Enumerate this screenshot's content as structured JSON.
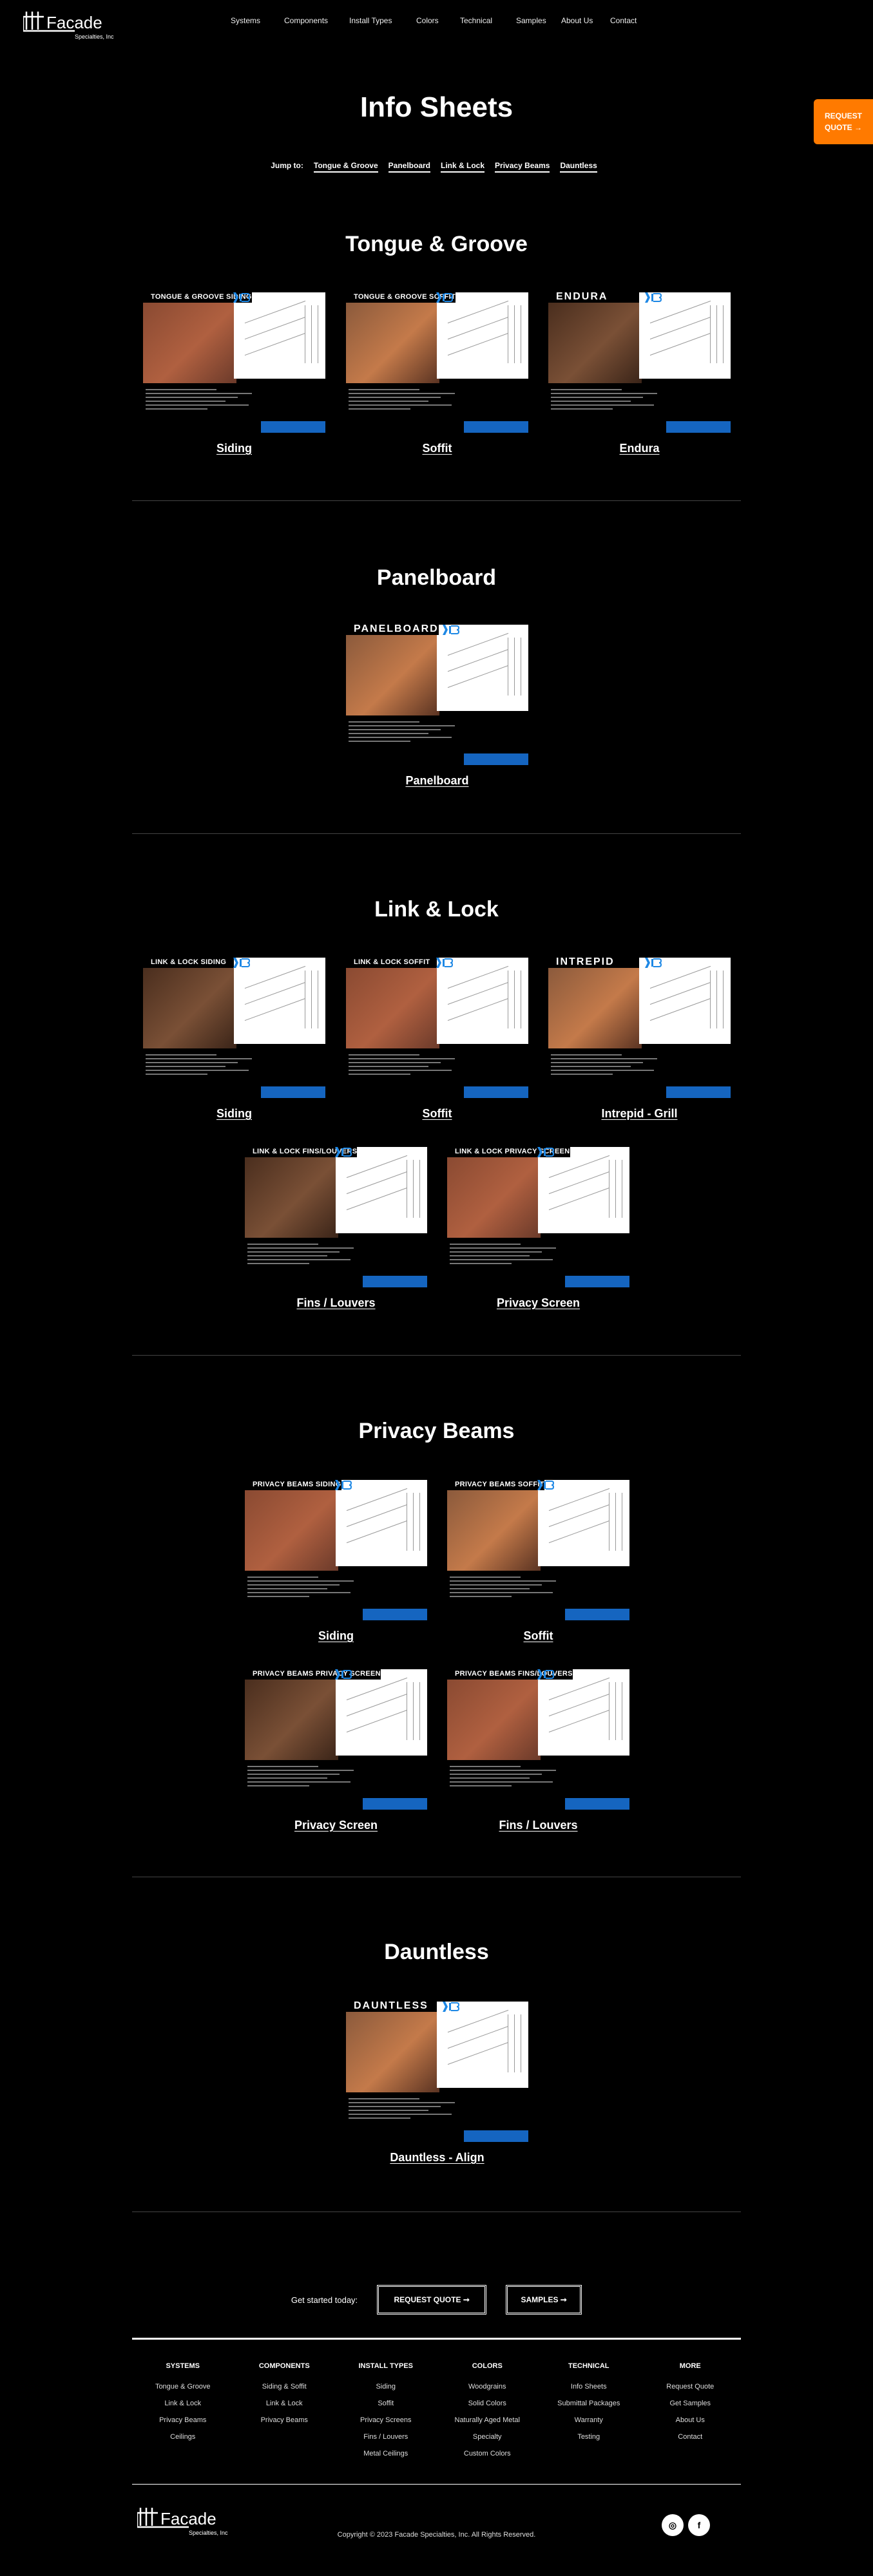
{
  "brand": {
    "name": "Facade",
    "subtitle": "Specialties, Inc"
  },
  "nav": [
    "Systems",
    "Components",
    "Install Types",
    "Colors",
    "Technical",
    "Samples",
    "About Us",
    "Contact"
  ],
  "request_tab": {
    "line1": "REQUEST",
    "line2": "QUOTE →",
    "color": "#ff7a00"
  },
  "page_title": "Info Sheets",
  "jump": {
    "label": "Jump to:",
    "links": [
      "Tongue & Groove",
      "Panelboard",
      "Link & Lock",
      "Privacy Beams",
      "Dauntless"
    ]
  },
  "sections": [
    {
      "title": "Tongue & Groove",
      "sheets": [
        {
          "header": "TONGUE & GROOVE SIDING",
          "caption": "Siding"
        },
        {
          "header": "TONGUE & GROOVE SOFFIT",
          "caption": "Soffit"
        },
        {
          "header": "ENDURA",
          "caption": "Endura"
        }
      ]
    },
    {
      "title": "Panelboard",
      "sheets": [
        {
          "header": "PANELBOARD",
          "caption": "Panelboard"
        }
      ]
    },
    {
      "title": "Link & Lock",
      "sheets": [
        {
          "header": "LINK & LOCK SIDING",
          "caption": "Siding"
        },
        {
          "header": "LINK & LOCK SOFFIT",
          "caption": "Soffit"
        },
        {
          "header": "INTREPID",
          "caption": "Intrepid - Grill"
        },
        {
          "header": "LINK & LOCK FINS/LOUVERS",
          "caption": "Fins / Louvers"
        },
        {
          "header": "LINK & LOCK PRIVACY SCREEN",
          "caption": "Privacy Screen"
        }
      ]
    },
    {
      "title": "Privacy Beams",
      "sheets": [
        {
          "header": "PRIVACY BEAMS SIDING",
          "caption": "Siding"
        },
        {
          "header": "PRIVACY BEAMS SOFFIT",
          "caption": "Soffit"
        },
        {
          "header": "PRIVACY BEAMS PRIVACY SCREEN",
          "caption": "Privacy Screen"
        },
        {
          "header": "PRIVACY BEAMS FINS/LOUVERS",
          "caption": "Fins / Louvers"
        }
      ]
    },
    {
      "title": "Dauntless",
      "sheets": [
        {
          "header": "DAUNTLESS",
          "caption": "Dauntless - Align"
        }
      ]
    }
  ],
  "cta": {
    "label": "Get started today:",
    "quote": "REQUEST QUOTE ➞",
    "samples": "SAMPLES ➞"
  },
  "footer": {
    "columns": [
      {
        "title": "SYSTEMS",
        "links": [
          "Tongue & Groove",
          "Link & Lock",
          "Privacy Beams",
          "Ceilings"
        ]
      },
      {
        "title": "COMPONENTS",
        "links": [
          "Siding & Soffit",
          "Link & Lock",
          "Privacy Beams"
        ]
      },
      {
        "title": "INSTALL TYPES",
        "links": [
          "Siding",
          "Soffit",
          "Privacy Screens",
          "Fins / Louvers",
          "Metal Ceilings"
        ]
      },
      {
        "title": "COLORS",
        "links": [
          "Woodgrains",
          "Solid Colors",
          "Naturally Aged Metal",
          "Specialty",
          "Custom Colors"
        ]
      },
      {
        "title": "TECHNICAL",
        "links": [
          "Info Sheets",
          "Submittal Packages",
          "Warranty",
          "Testing"
        ]
      },
      {
        "title": "MORE",
        "links": [
          "Request Quote",
          "Get Samples",
          "About Us",
          "Contact"
        ]
      }
    ],
    "copyright": "Copyright © 2023 Facade Specialties, Inc. All Rights Reserved.",
    "social": [
      {
        "icon": "instagram-icon",
        "glyph": "◎"
      },
      {
        "icon": "facebook-icon",
        "glyph": "f"
      }
    ]
  }
}
